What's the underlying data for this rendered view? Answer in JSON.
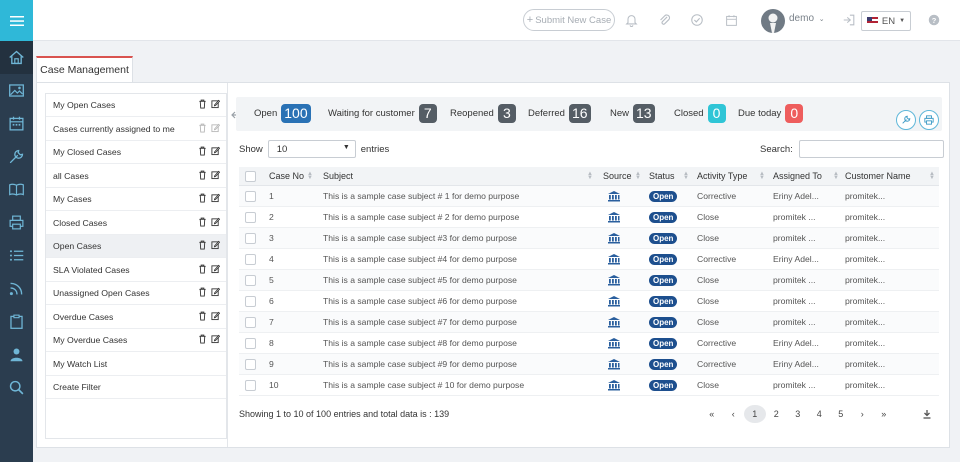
{
  "topbar": {
    "submit_label": "Submit New Case",
    "user_name": "demo",
    "language": "EN"
  },
  "tab": {
    "label": "Case Management"
  },
  "filters": [
    {
      "label": "My Open Cases",
      "actions": true,
      "active": false
    },
    {
      "label": "Cases currently assigned to me",
      "actions": true,
      "active": false
    },
    {
      "label": "My Closed Cases",
      "actions": true,
      "active": false
    },
    {
      "label": "all Cases",
      "actions": true,
      "active": false
    },
    {
      "label": "My Cases",
      "actions": true,
      "active": false
    },
    {
      "label": "Closed Cases",
      "actions": true,
      "active": false
    },
    {
      "label": "Open Cases",
      "actions": true,
      "active": true
    },
    {
      "label": "SLA Violated Cases",
      "actions": true,
      "active": false
    },
    {
      "label": "Unassigned Open Cases",
      "actions": true,
      "active": false
    },
    {
      "label": "Overdue Cases",
      "actions": true,
      "active": false
    },
    {
      "label": "My Overdue Cases",
      "actions": true,
      "active": false
    },
    {
      "label": "My Watch List",
      "actions": false,
      "active": false
    },
    {
      "label": "Create Filter",
      "actions": false,
      "active": false
    }
  ],
  "counters": [
    {
      "label": "Open",
      "value": "100",
      "color": "#2a72b5"
    },
    {
      "label": "Waiting for customer",
      "value": "7",
      "color": "#555d65"
    },
    {
      "label": "Reopened",
      "value": "3",
      "color": "#555d65"
    },
    {
      "label": "Deferred",
      "value": "16",
      "color": "#555d65"
    },
    {
      "label": "New",
      "value": "13",
      "color": "#555d65"
    },
    {
      "label": "Closed",
      "value": "0",
      "color": "#2fc5d6"
    },
    {
      "label": "Due today",
      "value": "0",
      "color": "#ee5d5d"
    }
  ],
  "controls": {
    "show_label": "Show",
    "page_size": "10",
    "entries_label": "entries",
    "search_label": "Search:"
  },
  "table": {
    "headers": [
      "Case No",
      "Subject",
      "Source",
      "Status",
      "Activity Type",
      "Assigned To",
      "Customer Name"
    ],
    "rows": [
      {
        "no": "1",
        "subject": "This is a sample case subject # 1 for demo purpose",
        "status": "Open",
        "activity": "Corrective",
        "assigned": "Eriny Adel...",
        "customer": "promitek..."
      },
      {
        "no": "2",
        "subject": "This is a sample case subject # 2 for demo purpose",
        "status": "Open",
        "activity": "Close",
        "assigned": "promitek ...",
        "customer": "promitek..."
      },
      {
        "no": "3",
        "subject": "This is a sample case subject #3 for demo purpose",
        "status": "Open",
        "activity": "Close",
        "assigned": "promitek ...",
        "customer": "promitek..."
      },
      {
        "no": "4",
        "subject": "This is a sample case subject #4 for demo purpose",
        "status": "Open",
        "activity": "Corrective",
        "assigned": "Eriny Adel...",
        "customer": "promitek..."
      },
      {
        "no": "5",
        "subject": "This is a sample case subject #5 for demo purpose",
        "status": "Open",
        "activity": "Close",
        "assigned": "promitek ...",
        "customer": "promitek..."
      },
      {
        "no": "6",
        "subject": "This is a sample case subject #6 for demo purpose",
        "status": "Open",
        "activity": "Close",
        "assigned": "promitek ...",
        "customer": "promitek..."
      },
      {
        "no": "7",
        "subject": "This is a sample case subject #7 for demo purpose",
        "status": "Open",
        "activity": "Close",
        "assigned": "promitek ...",
        "customer": "promitek..."
      },
      {
        "no": "8",
        "subject": "This is a sample case subject #8 for demo purpose",
        "status": "Open",
        "activity": "Corrective",
        "assigned": "Eriny Adel...",
        "customer": "promitek..."
      },
      {
        "no": "9",
        "subject": "This is a sample case subject #9 for demo purpose",
        "status": "Open",
        "activity": "Corrective",
        "assigned": "Eriny Adel...",
        "customer": "promitek..."
      },
      {
        "no": "10",
        "subject": "This is a sample case subject # 10 for demo purpose",
        "status": "Open",
        "activity": "Close",
        "assigned": "promitek ...",
        "customer": "promitek..."
      }
    ]
  },
  "footer": {
    "info": "Showing 1 to 10 of 100 entries and total data is : 139"
  },
  "pagination": {
    "first": "«",
    "prev": "‹",
    "pages": [
      "1",
      "2",
      "3",
      "4",
      "5"
    ],
    "current": "1",
    "next": "›",
    "last": "»"
  },
  "icons": {
    "rail": [
      "menu-icon",
      "home-icon",
      "image-icon",
      "calendar-icon",
      "wrench-icon",
      "book-icon",
      "print-icon",
      "list-icon",
      "rss-icon",
      "clipboard-icon",
      "user-icon",
      "search-icon"
    ],
    "topbar": [
      "bell-icon",
      "paperclip-icon",
      "check-circle-icon",
      "calendar-icon",
      "logout-icon",
      "help-icon"
    ]
  }
}
